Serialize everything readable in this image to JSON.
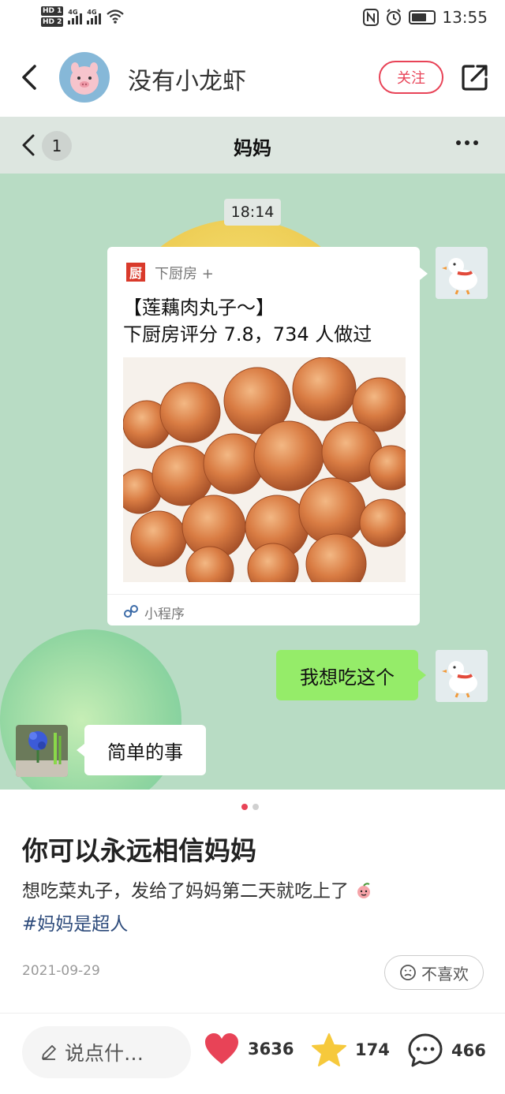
{
  "status_bar": {
    "time": "13:55",
    "net1": "4G",
    "net2": "4G",
    "hd1": "HD 1",
    "hd2": "HD 2"
  },
  "header": {
    "username": "没有小龙虾",
    "follow_label": "关注"
  },
  "chat": {
    "back_count": "1",
    "title": "妈妈",
    "timestamp": "18:14",
    "card": {
      "app_name": "下厨房 +",
      "logo_char": "厨",
      "title_line1": "【莲藕肉丸子～】",
      "title_line2": "下厨房评分 7.8，734 人做过",
      "footer_label": "小程序"
    },
    "my_message": "我想吃这个",
    "their_message": "简单的事"
  },
  "carousel": {
    "count": 2,
    "active_index": 0
  },
  "post": {
    "title": "你可以永远相信妈妈",
    "body": "想吃菜丸子，发给了妈妈第二天就吃上了",
    "hashtag": "#妈妈是超人",
    "date": "2021-09-29",
    "dislike_label": "不喜欢"
  },
  "bottom_bar": {
    "comment_placeholder": "说点什…",
    "likes": "3636",
    "favorites": "174",
    "comments": "466"
  },
  "colors": {
    "accent_red": "#e84357",
    "chat_bg": "#b8dcc4",
    "bubble_green": "#95ec69",
    "star_yellow": "#f6c93c",
    "hashtag_blue": "#2d4b7b"
  },
  "icons": [
    "back-arrow-icon",
    "share-icon",
    "more-icon",
    "mini-program-icon",
    "pencil-icon",
    "heart-icon",
    "star-icon",
    "comment-icon",
    "sad-face-icon"
  ]
}
